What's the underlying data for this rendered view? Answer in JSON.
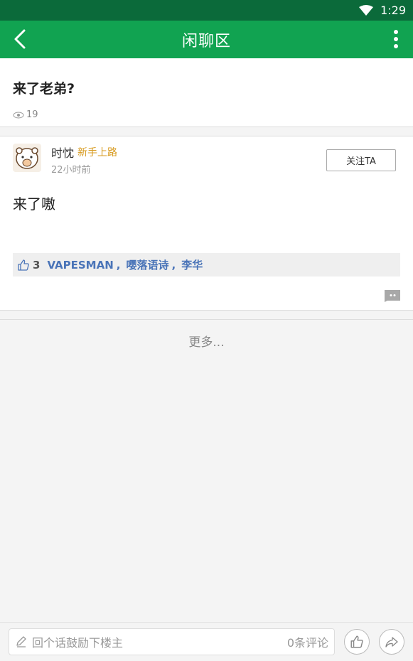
{
  "status_bar": {
    "time": "1:29"
  },
  "app_bar": {
    "title": "闲聊区"
  },
  "post": {
    "title": "来了老弟?",
    "views": "19"
  },
  "reply": {
    "username": "时忱",
    "level": "新手上路",
    "time": "22小时前",
    "follow_label": "关注TA",
    "content": "来了嗷",
    "likes": {
      "count": "3",
      "users": [
        "VAPESMAN",
        "嘤落语诗",
        "李华"
      ],
      "separator": ","
    }
  },
  "more_label": "更多...",
  "bottom_bar": {
    "input_placeholder": "回个话鼓励下楼主",
    "comment_count": "0条评论"
  },
  "colors": {
    "status_bar": "#0b6a3a",
    "app_bar": "#11a351",
    "level": "#d79a1e",
    "liker": "#4a74b8"
  }
}
